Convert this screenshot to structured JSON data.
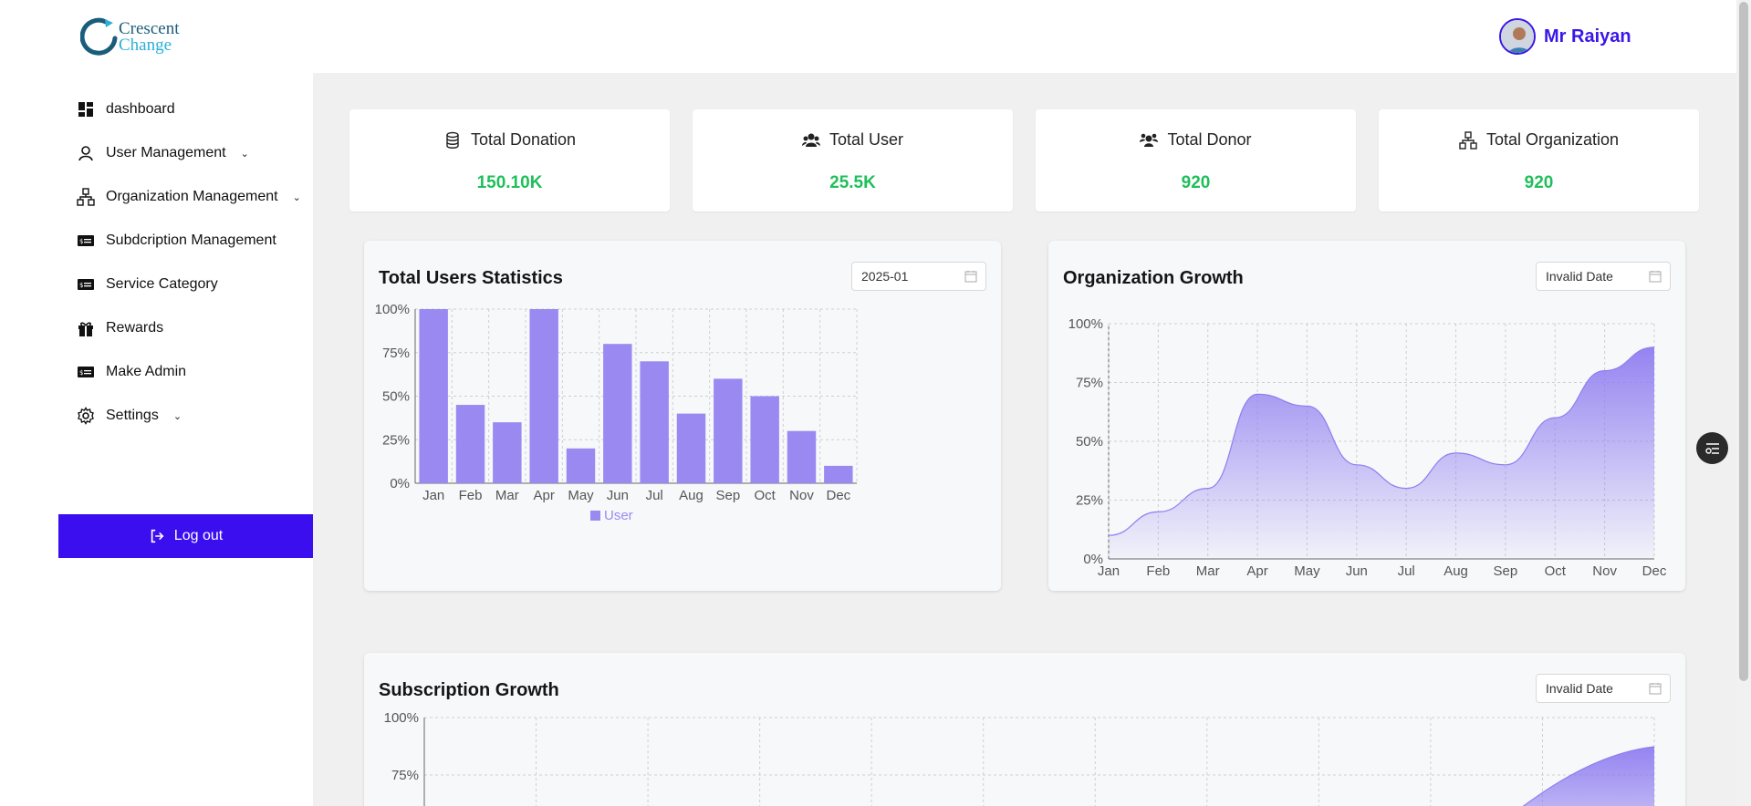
{
  "brand": {
    "line1": "Crescent",
    "line2": "Change"
  },
  "profile": {
    "name": "Mr Raiyan"
  },
  "sidebar": {
    "items": [
      {
        "label": "dashboard",
        "icon": "dashboard-icon"
      },
      {
        "label": "User Management",
        "icon": "user-icon",
        "has_chevron": true
      },
      {
        "label": "Organization Management",
        "icon": "organization-icon",
        "has_chevron": true
      },
      {
        "label": "Subdcription Management",
        "icon": "subscription-icon"
      },
      {
        "label": "Service Category",
        "icon": "card-icon"
      },
      {
        "label": "Rewards",
        "icon": "gift-icon"
      },
      {
        "label": "Make Admin",
        "icon": "card-icon"
      },
      {
        "label": "Settings",
        "icon": "gear-icon",
        "has_chevron": true
      }
    ],
    "logout_label": "Log out"
  },
  "stats": [
    {
      "title": "Total Donation",
      "value": "150.10K",
      "icon": "database-icon"
    },
    {
      "title": "Total User",
      "value": "25.5K",
      "icon": "users-icon"
    },
    {
      "title": "Total Donor",
      "value": "920",
      "icon": "team-icon"
    },
    {
      "title": "Total Organization",
      "value": "920",
      "icon": "organization-icon"
    }
  ],
  "cards": {
    "users": {
      "title": "Total Users Statistics",
      "date": "2025-01"
    },
    "org": {
      "title": "Organization Growth",
      "date": "Invalid Date"
    },
    "sub": {
      "title": "Subscription Growth",
      "date": "Invalid Date"
    }
  },
  "colors": {
    "accent": "#3b0ef0",
    "bar": "#9b89f2",
    "value_green": "#1fbf5a"
  },
  "chart_data": [
    {
      "type": "bar",
      "title": "Total Users Statistics",
      "categories": [
        "Jan",
        "Feb",
        "Mar",
        "Apr",
        "May",
        "Jun",
        "Jul",
        "Aug",
        "Sep",
        "Oct",
        "Nov",
        "Dec"
      ],
      "series": [
        {
          "name": "User",
          "values": [
            100,
            45,
            35,
            100,
            20,
            80,
            70,
            40,
            60,
            50,
            30,
            10
          ]
        }
      ],
      "yticks": [
        "0%",
        "25%",
        "50%",
        "75%",
        "100%"
      ],
      "ylim": [
        0,
        100
      ],
      "grid": true,
      "legend": "bottom"
    },
    {
      "type": "area",
      "title": "Organization Growth",
      "categories": [
        "Jan",
        "Feb",
        "Mar",
        "Apr",
        "May",
        "Jun",
        "Jul",
        "Aug",
        "Sep",
        "Oct",
        "Nov",
        "Dec"
      ],
      "values": [
        10,
        20,
        30,
        70,
        65,
        40,
        30,
        45,
        40,
        60,
        80,
        90
      ],
      "yticks": [
        "0%",
        "25%",
        "50%",
        "75%",
        "100%"
      ],
      "ylim": [
        0,
        100
      ],
      "grid": true
    },
    {
      "type": "area",
      "title": "Subscription Growth",
      "yticks": [
        "75%",
        "100%"
      ],
      "ylim": [
        0,
        100
      ],
      "grid": true
    }
  ]
}
